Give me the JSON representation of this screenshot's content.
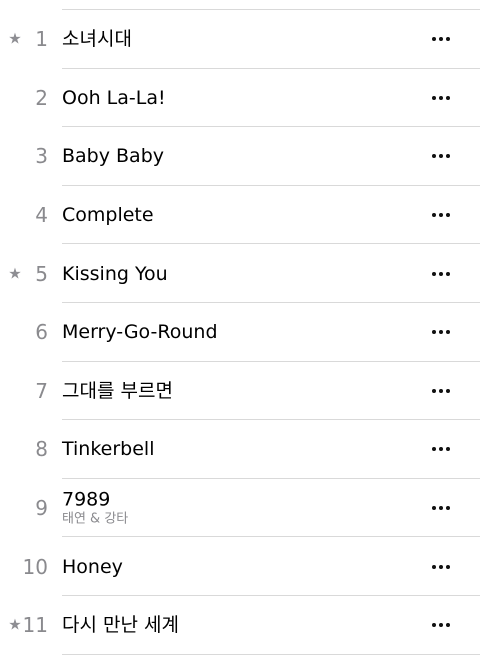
{
  "icons": {
    "favorite": "star-icon",
    "more": "ellipsis-icon"
  },
  "colors": {
    "separator": "#d9d9d9",
    "secondary_text": "#8a8a8e",
    "star": "#8e8e93"
  },
  "tracks": [
    {
      "number": "1",
      "title": "소녀시대",
      "subtitle": "",
      "favorite": true
    },
    {
      "number": "2",
      "title": "Ooh La-La!",
      "subtitle": "",
      "favorite": false
    },
    {
      "number": "3",
      "title": "Baby Baby",
      "subtitle": "",
      "favorite": false
    },
    {
      "number": "4",
      "title": "Complete",
      "subtitle": "",
      "favorite": false
    },
    {
      "number": "5",
      "title": "Kissing You",
      "subtitle": "",
      "favorite": true
    },
    {
      "number": "6",
      "title": "Merry-Go-Round",
      "subtitle": "",
      "favorite": false
    },
    {
      "number": "7",
      "title": "그대를 부르면",
      "subtitle": "",
      "favorite": false
    },
    {
      "number": "8",
      "title": "Tinkerbell",
      "subtitle": "",
      "favorite": false
    },
    {
      "number": "9",
      "title": "7989",
      "subtitle": "태연 & 강타",
      "favorite": false
    },
    {
      "number": "10",
      "title": "Honey",
      "subtitle": "",
      "favorite": false
    },
    {
      "number": "11",
      "title": "다시 만난 세계",
      "subtitle": "",
      "favorite": true
    }
  ],
  "star_glyph": "★"
}
